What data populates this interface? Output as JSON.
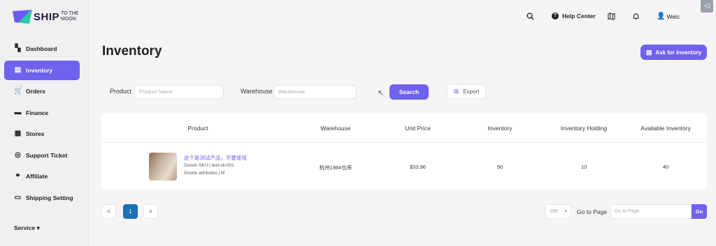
{
  "logo": {
    "text": "SHIP",
    "sub1": "TO THE",
    "sub2": "MOON"
  },
  "sidebar": {
    "items": [
      {
        "label": "Dashboard",
        "icon": "dashboard-icon",
        "glyph": "▚"
      },
      {
        "label": "Inventory",
        "icon": "inventory-box-icon",
        "glyph": "▤"
      },
      {
        "label": "Orders",
        "icon": "cart-icon",
        "glyph": "🛒"
      },
      {
        "label": "Finance",
        "icon": "card-icon",
        "glyph": "▬"
      },
      {
        "label": "Stores",
        "icon": "store-icon",
        "glyph": "▦"
      },
      {
        "label": "Support Ticket",
        "icon": "headset-icon",
        "glyph": "◎"
      },
      {
        "label": "Affiliate",
        "icon": "network-icon",
        "glyph": "⚭"
      },
      {
        "label": "Shipping Setting",
        "icon": "truck-icon",
        "glyph": "▭"
      }
    ],
    "service": "Service"
  },
  "topbar": {
    "help": "Help Center",
    "welcome": "Welc"
  },
  "page": {
    "title": "Inventory",
    "ask_button": "Ask for Inventory"
  },
  "filters": {
    "product_label": "Product",
    "product_placeholder": "Product Name",
    "warehouse_label": "Warehouse",
    "warehouse_placeholder": "Warehouse",
    "search_button": "Search",
    "export_button": "Export"
  },
  "table": {
    "headers": [
      "Product",
      "Warehouse",
      "Unit Price",
      "Inventory",
      "Inventory Holding",
      "Available Inventory"
    ],
    "rows": [
      {
        "name": "这个是测试产品，不要使用",
        "sku": "Goods SKU | test-sk-001",
        "attributes": "Goods attributes | M",
        "warehouse": "杭州1984仓库",
        "unit_price": "$33.96",
        "inventory": "50",
        "holding": "10",
        "available": "40"
      }
    ]
  },
  "pager": {
    "prev": "<",
    "current": "1",
    "next": ">",
    "page_size": "100",
    "goto_label": "Go to Page",
    "goto_placeholder": "Go to Page",
    "go": "Go"
  },
  "colors": {
    "accent": "#7061ee",
    "pager_active": "#1b6fb4"
  }
}
